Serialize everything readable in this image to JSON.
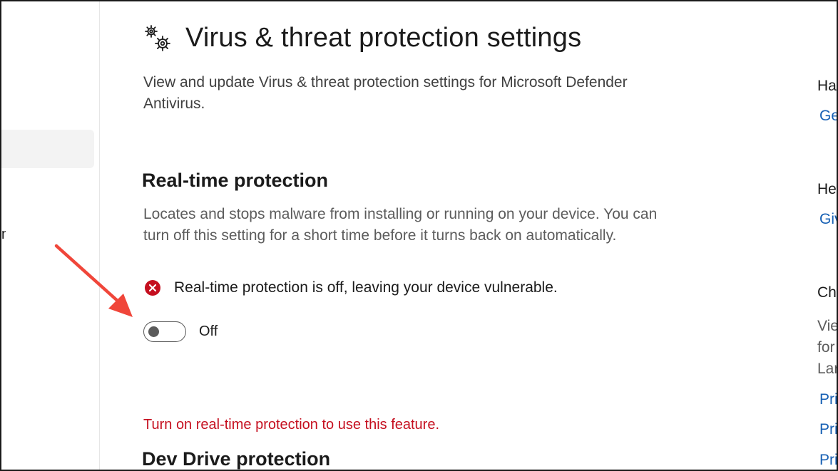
{
  "header": {
    "title": "Virus & threat protection settings",
    "description": "View and update Virus & threat protection settings for Microsoft Defender Antivirus.",
    "icon": "gears-icon"
  },
  "nav": {
    "partial_label": "n"
  },
  "realtime": {
    "title": "Real-time protection",
    "description": "Locates and stops malware from installing or running on your device. You can turn off this setting for a short time before it turns back on automatically.",
    "status_text": "Real-time protection is off, leaving your device vulnerable.",
    "status_icon": "error-icon",
    "toggle_state": "off",
    "toggle_label": "Off"
  },
  "warning": "Turn on real-time protection to use this feature.",
  "dev_drive": {
    "title": "Dev Drive protection"
  },
  "right_pane": {
    "head1": "Hav",
    "link1": "Ge",
    "head2": "Hel",
    "link2": "Giv",
    "head3": "Cha",
    "body1": "Vie",
    "body2": "for",
    "body3": "Lar",
    "link3": "Pri",
    "link4": "Pri",
    "link5": "Pri"
  },
  "colors": {
    "error": "#c50f1f",
    "link": "#1760b4",
    "arrow": "#f0463a"
  }
}
